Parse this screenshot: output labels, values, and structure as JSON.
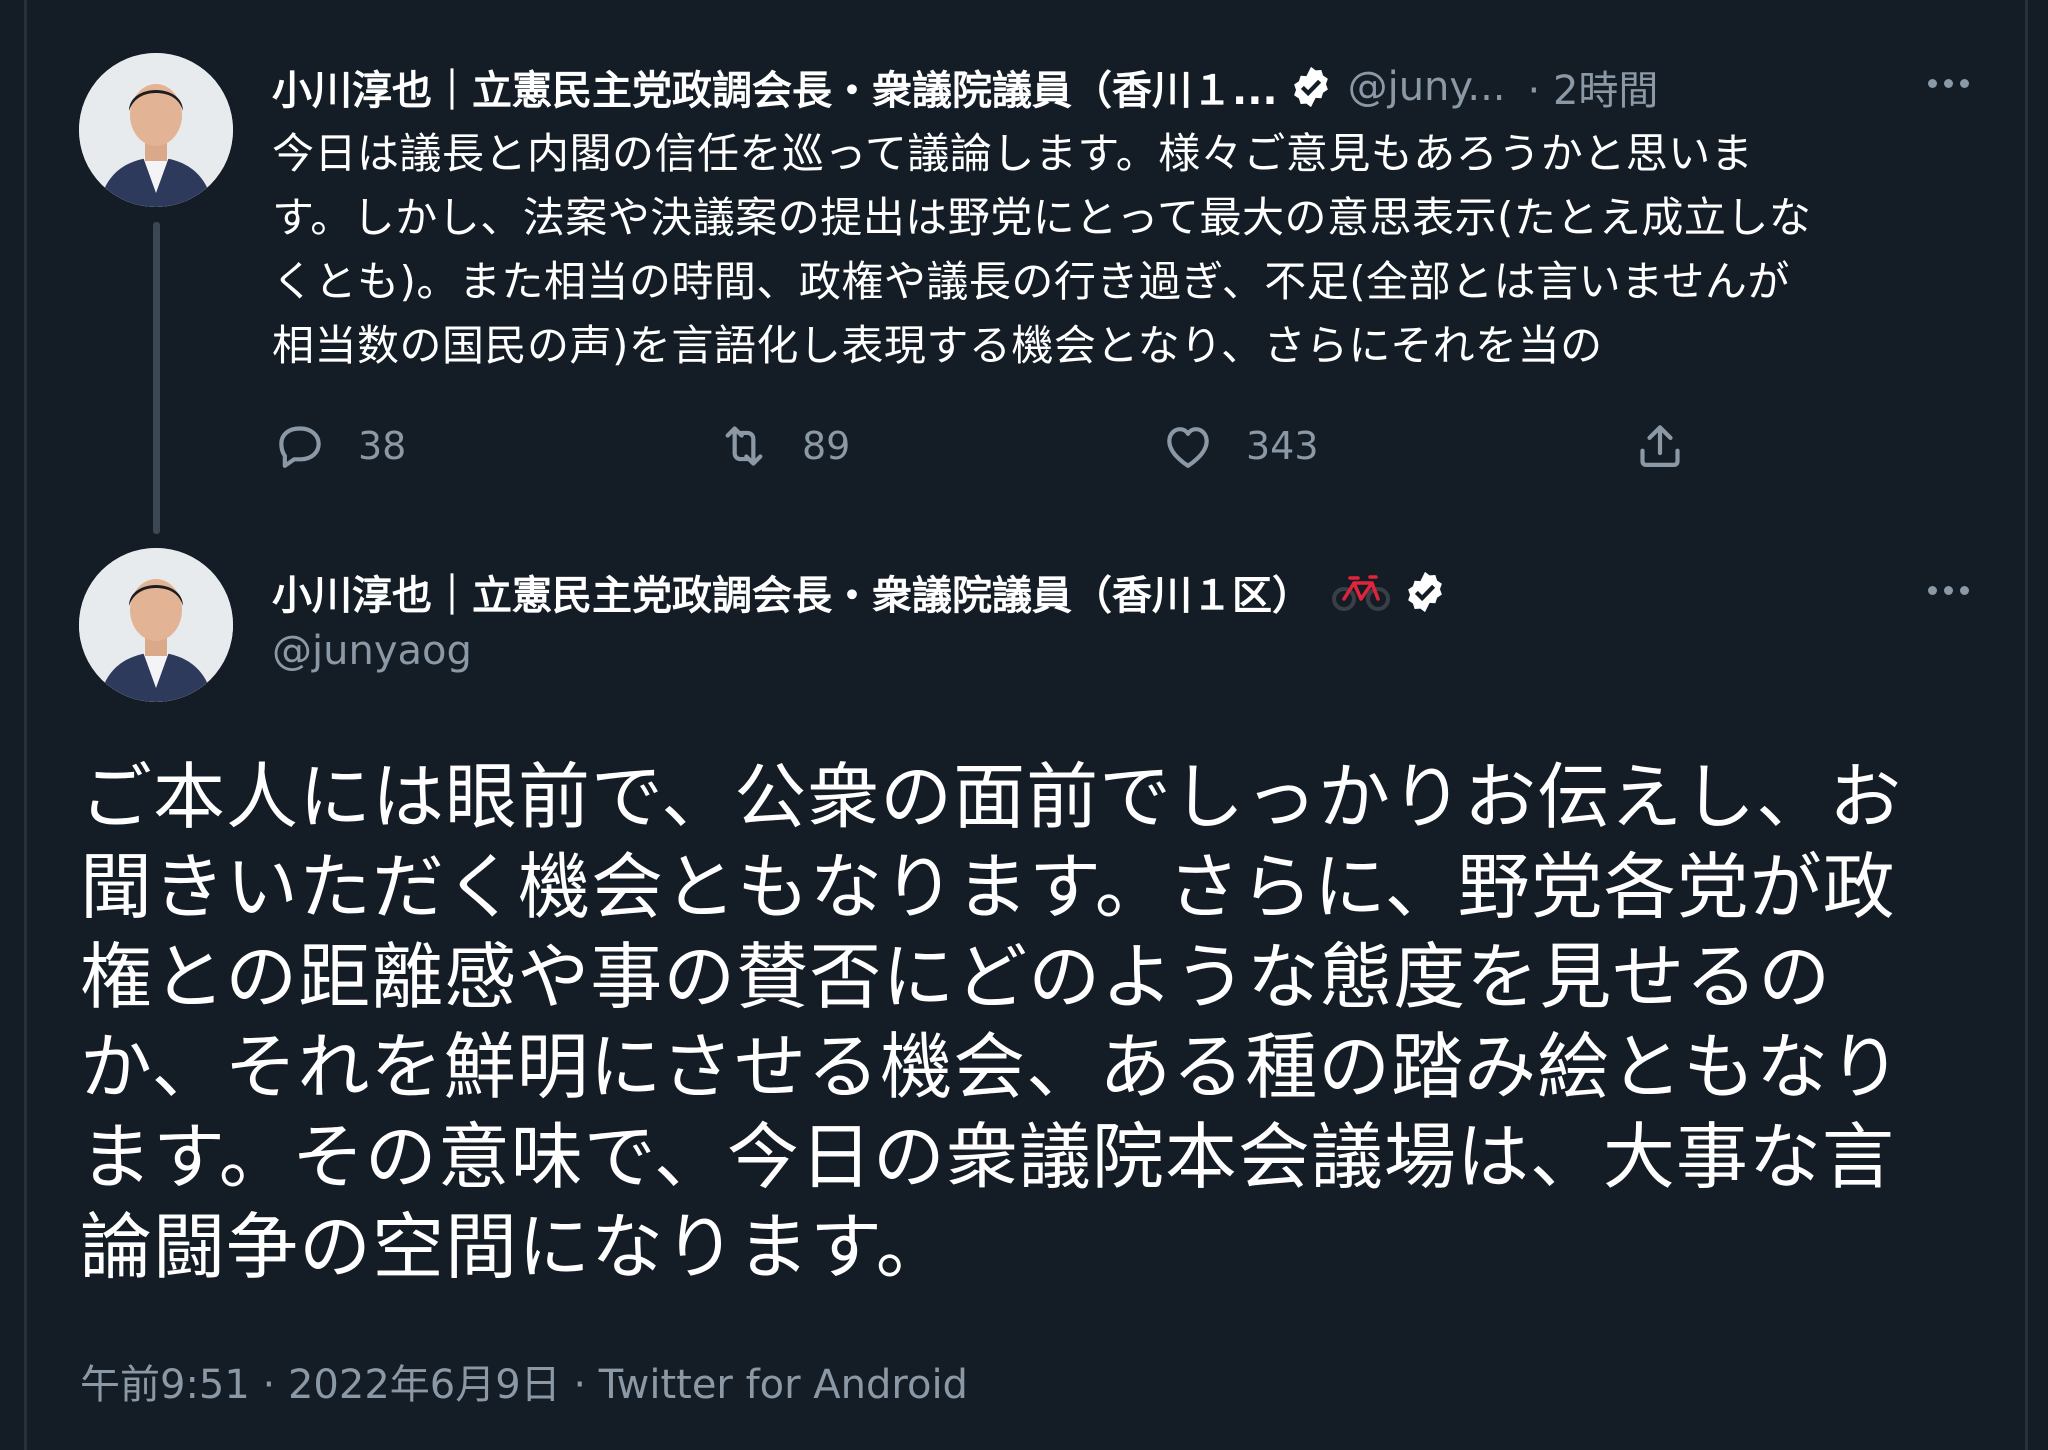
{
  "reply_tweet": {
    "display_name": "小川淳也｜立憲民主党政調会長・衆議院議員（香川１...",
    "handle": "@juny...",
    "time": "· 2時間",
    "text_lines": [
      "今日は議長と内閣の信任を巡って議論します。様々ご意見もあろうかと思いま",
      "す。しかし、法案や決議案の提出は野党にとって最大の意思表示(たとえ成立しな",
      "くとも)。また相当の時間、政権や議長の行き過ぎ、不足(全部とは言いませんが",
      "相当数の国民の声)を言語化し表現する機会となり、さらにそれを当の"
    ],
    "actions": {
      "reply_count": "38",
      "retweet_count": "89",
      "like_count": "343"
    }
  },
  "main_tweet": {
    "display_name": "小川淳也｜立憲民主党政調会長・衆議院議員（香川１区）",
    "handle": "@junyaog",
    "text_lines": [
      "ご本人には眼前で、公衆の面前でしっかりお伝えし、お",
      "聞きいただく機会ともなります。さらに、野党各党が政",
      "権との距離感や事の賛否にどのような態度を見せるの",
      "か、それを鮮明にさせる機会、ある種の踏み絵ともなり",
      "ます。その意味で、今日の衆議院本会議場は、大事な言",
      "論闘争の空間になります。"
    ],
    "meta": "午前9:51 · 2022年6月9日 · Twitter for Android"
  },
  "icons": {
    "verified": "verified-badge-icon",
    "bicycle": "bicycle-emoji-icon",
    "reply": "reply-icon",
    "retweet": "retweet-icon",
    "like": "heart-icon",
    "share": "share-icon",
    "more": "more-options-icon"
  },
  "colors": {
    "background": "#141d26",
    "text": "#ffffff",
    "secondary_text": "#8b98a5",
    "thread_line": "#3b4753",
    "bicycle_red": "#e0243b"
  }
}
